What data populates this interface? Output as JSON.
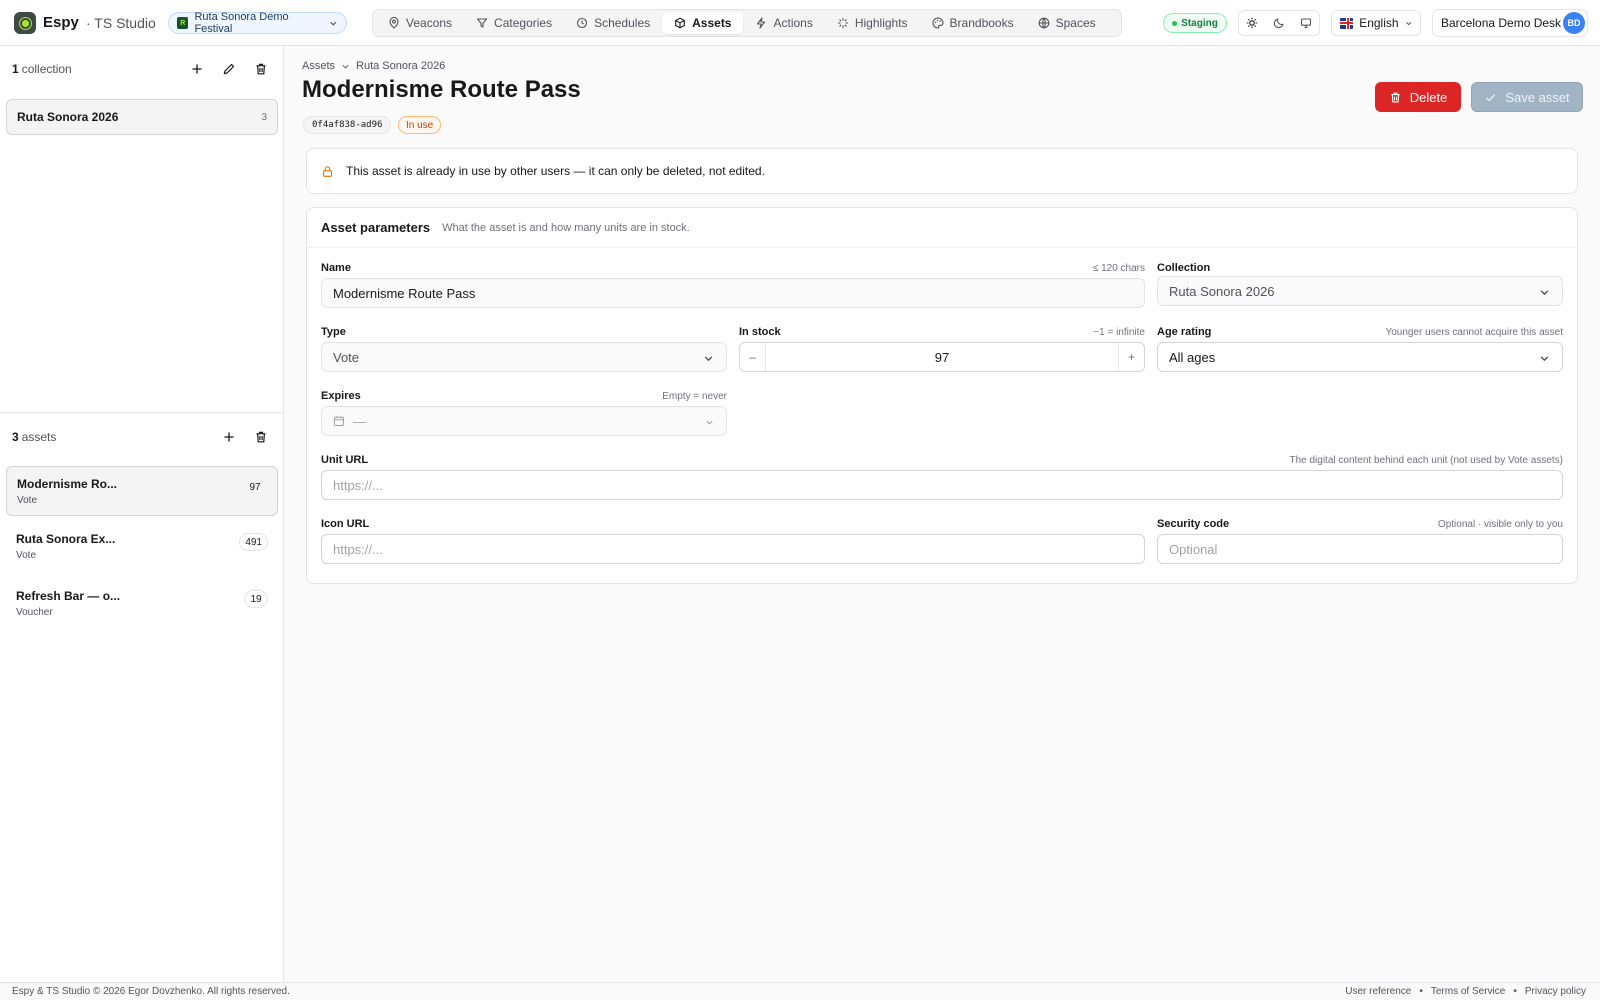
{
  "header": {
    "brand": "Espy",
    "studio": "· TS Studio",
    "festival": "Ruta Sonora Demo Festival",
    "festival_mark": "R",
    "nav": [
      {
        "label": "Veacons",
        "icon": "map-pin-icon"
      },
      {
        "label": "Categories",
        "icon": "filter-icon"
      },
      {
        "label": "Schedules",
        "icon": "clock-icon"
      },
      {
        "label": "Assets",
        "icon": "box-icon",
        "active": true
      },
      {
        "label": "Actions",
        "icon": "bolt-icon"
      },
      {
        "label": "Highlights",
        "icon": "sparkle-icon"
      },
      {
        "label": "Brandbooks",
        "icon": "palette-icon"
      },
      {
        "label": "Spaces",
        "icon": "globe-icon"
      }
    ],
    "env": "Staging",
    "language": "English",
    "user_name": "Barcelona Demo Desk",
    "user_initials": "BD"
  },
  "sidebar": {
    "collections_count": "1",
    "collections_label": "collection",
    "collections": [
      {
        "name": "Ruta Sonora 2026",
        "count": "3"
      }
    ],
    "assets_count": "3",
    "assets_label": "assets",
    "assets": [
      {
        "name": "Modernisme Ro...",
        "type": "Vote",
        "count": "97",
        "selected": true
      },
      {
        "name": "Ruta Sonora Ex...",
        "type": "Vote",
        "count": "491"
      },
      {
        "name": "Refresh Bar — o...",
        "type": "Voucher",
        "count": "19"
      }
    ]
  },
  "main": {
    "breadcrumb_root": "Assets",
    "breadcrumb_current": "Ruta Sonora 2026",
    "title": "Modernisme Route Pass",
    "uid": "0f4af838-ad96",
    "status_badge": "In use",
    "delete_label": "Delete",
    "save_label": "Save asset",
    "notice": "This asset is already in use by other users — it can only be deleted, not edited.",
    "card_title": "Asset parameters",
    "card_subtitle": "What the asset is and how many units are in stock.",
    "fields": {
      "name": {
        "label": "Name",
        "hint": "≤ 120 chars",
        "value": "Modernisme Route Pass"
      },
      "collection": {
        "label": "Collection",
        "value": "Ruta Sonora 2026"
      },
      "type": {
        "label": "Type",
        "value": "Vote"
      },
      "stock": {
        "label": "In stock",
        "hint": "−1 = infinite",
        "value": "97",
        "minus": "–",
        "plus": "+"
      },
      "age": {
        "label": "Age rating",
        "hint": "Younger users cannot acquire this asset",
        "value": "All ages"
      },
      "expires": {
        "label": "Expires",
        "hint": "Empty = never",
        "value": "—"
      },
      "unit_url": {
        "label": "Unit URL",
        "hint": "The digital content behind each unit (not used by Vote assets)",
        "placeholder": "https://..."
      },
      "icon_url": {
        "label": "Icon URL",
        "placeholder": "https://..."
      },
      "security": {
        "label": "Security code",
        "hint": "Optional · visible only to you",
        "placeholder": "Optional"
      }
    }
  },
  "footer": {
    "copyright": "Espy & TS Studio © 2026 Egor Dovzhenko. All rights reserved.",
    "links": [
      "User reference",
      "•",
      "Terms of Service",
      "•",
      "Privacy policy"
    ]
  },
  "colors": {
    "danger": "#dc2626",
    "accent_disabled": "#a1b4c6",
    "staging": "#15803d",
    "warning": "#c2410c"
  }
}
